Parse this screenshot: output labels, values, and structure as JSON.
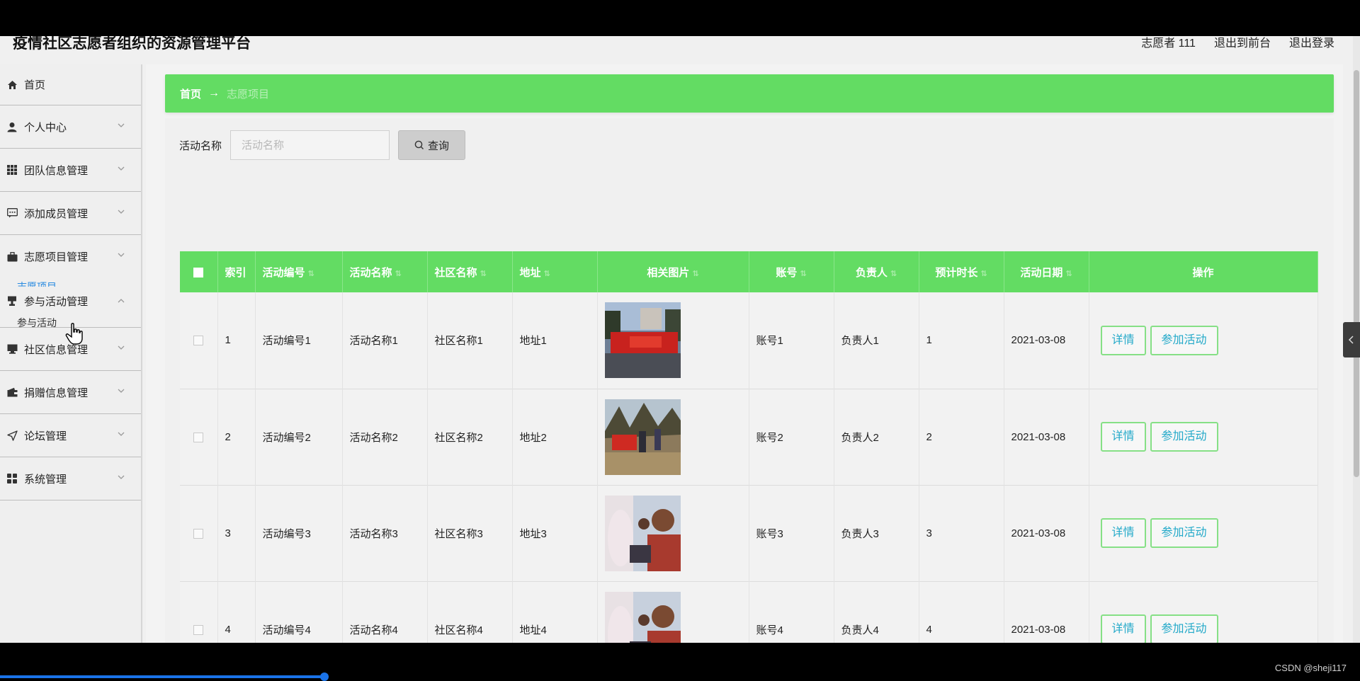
{
  "header": {
    "title": "疫情社区志愿者组织的资源管理平台",
    "user": "志愿者 111",
    "exit_front": "退出到前台",
    "logout": "退出登录"
  },
  "sidebar": {
    "items": [
      {
        "label": "首页",
        "icon": "home-icon"
      },
      {
        "label": "个人中心",
        "icon": "user-icon"
      },
      {
        "label": "团队信息管理",
        "icon": "grid-icon"
      },
      {
        "label": "添加成员管理",
        "icon": "message-icon"
      },
      {
        "label": "志愿项目管理",
        "icon": "briefcase-icon",
        "sub": "志愿项目"
      },
      {
        "label": "参与活动管理",
        "icon": "cup-icon",
        "sub": "参与活动"
      },
      {
        "label": "社区信息管理",
        "icon": "monitor-icon"
      },
      {
        "label": "捐赠信息管理",
        "icon": "wallet-icon"
      },
      {
        "label": "论坛管理",
        "icon": "send-icon"
      },
      {
        "label": "系统管理",
        "icon": "apps-icon"
      }
    ]
  },
  "breadcrumb": {
    "home": "首页",
    "arrow": "→",
    "current": "志愿项目"
  },
  "search": {
    "label": "活动名称",
    "placeholder": "活动名称",
    "button": "查询"
  },
  "table": {
    "headers": [
      "索引",
      "活动编号",
      "活动名称",
      "社区名称",
      "地址",
      "相关图片",
      "账号",
      "负责人",
      "预计时长",
      "活动日期",
      "操作"
    ],
    "rows": [
      {
        "index": "1",
        "code": "活动编号1",
        "name": "活动名称1",
        "community": "社区名称1",
        "address": "地址1",
        "account": "账号1",
        "leader": "负责人1",
        "duration": "1",
        "date": "2021-03-08"
      },
      {
        "index": "2",
        "code": "活动编号2",
        "name": "活动名称2",
        "community": "社区名称2",
        "address": "地址2",
        "account": "账号2",
        "leader": "负责人2",
        "duration": "2",
        "date": "2021-03-08"
      },
      {
        "index": "3",
        "code": "活动编号3",
        "name": "活动名称3",
        "community": "社区名称3",
        "address": "地址3",
        "account": "账号3",
        "leader": "负责人3",
        "duration": "3",
        "date": "2021-03-08"
      },
      {
        "index": "4",
        "code": "活动编号4",
        "name": "活动名称4",
        "community": "社区名称4",
        "address": "地址4",
        "account": "账号4",
        "leader": "负责人4",
        "duration": "4",
        "date": "2021-03-08"
      }
    ],
    "detail_label": "详情",
    "join_label": "参加活动"
  },
  "watermark": "CSDN @sheji117",
  "colors": {
    "accent_green": "#63dc63",
    "link_blue": "#23a9c9"
  }
}
